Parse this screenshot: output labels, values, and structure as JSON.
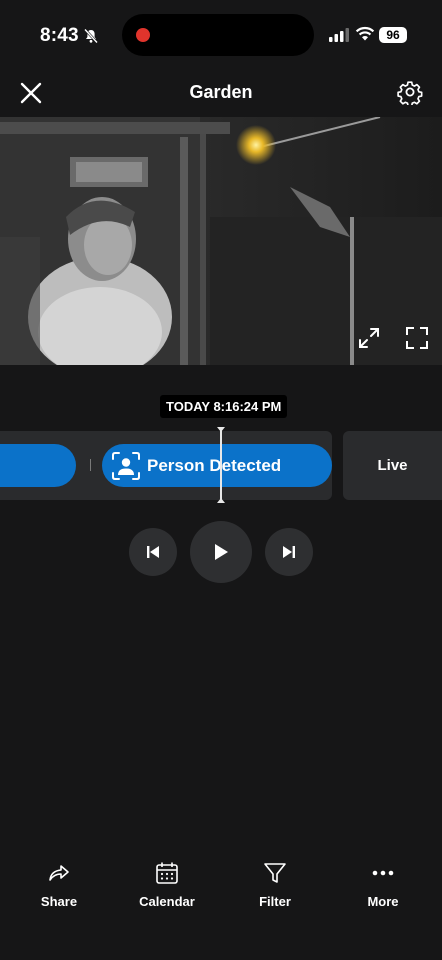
{
  "status_bar": {
    "time": "8:43",
    "battery": "96"
  },
  "header": {
    "title": "Garden"
  },
  "player": {
    "timestamp": "TODAY 8:16:24 PM",
    "event_label": "Person Detected",
    "live_label": "Live"
  },
  "bottom_bar": {
    "items": [
      {
        "label": "Share",
        "icon": "share-icon"
      },
      {
        "label": "Calendar",
        "icon": "calendar-icon"
      },
      {
        "label": "Filter",
        "icon": "filter-icon"
      },
      {
        "label": "More",
        "icon": "more-icon"
      }
    ]
  },
  "colors": {
    "background": "#161617",
    "accent": "#0b72c9",
    "panel": "#2a2b2d",
    "record": "#e0342c"
  }
}
